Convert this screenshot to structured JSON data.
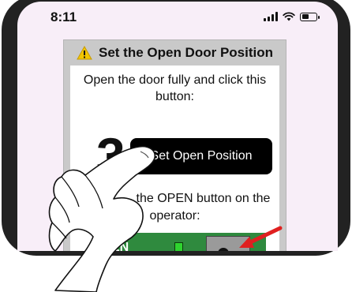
{
  "status_bar": {
    "time": "8:11",
    "icons": [
      "cellular-signal-icon",
      "wifi-icon",
      "battery-icon"
    ]
  },
  "card": {
    "title": "Set the Open Door Position",
    "warning_icon": "warning-icon",
    "instruction": "Open the door fully and click this button:",
    "step_number": "3",
    "button_label": "Set Open Position",
    "instruction_2_prefix": "the OPEN button on the",
    "instruction_2_suffix": "operator:"
  },
  "operator_panel": {
    "label": "EN",
    "led_color": "#2fd42f",
    "arrow_color": "#e02020"
  },
  "colors": {
    "screen_bg": "#f8eef8",
    "card_header_bg": "#c9c9c9",
    "button_bg": "#000000",
    "panel_green": "#2f8a3e"
  }
}
